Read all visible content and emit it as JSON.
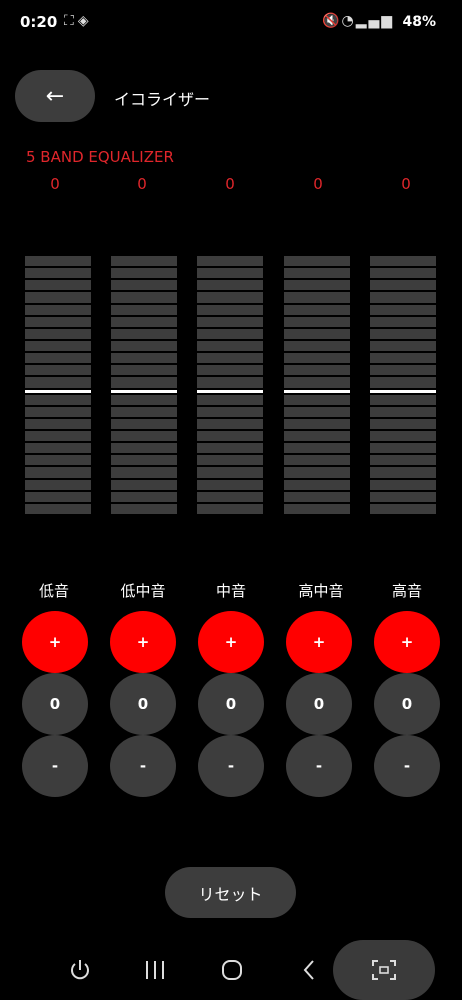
{
  "status_bar": {
    "time": "0:20",
    "battery": "48%",
    "left_icons": [
      "screenshot-icon",
      "alarm-icon"
    ],
    "right_icons": [
      "mute-icon",
      "wifi-icon",
      "signal-icon"
    ]
  },
  "header": {
    "back_label": "←",
    "title": "イコライザー"
  },
  "equalizer": {
    "label": "5 BAND EQUALIZER",
    "bands": [
      {
        "name": "低音",
        "value": "0",
        "plus": "+",
        "minus": "-"
      },
      {
        "name": "低中音",
        "value": "0",
        "plus": "+",
        "minus": "-"
      },
      {
        "name": "中音",
        "value": "0",
        "plus": "+",
        "minus": "-"
      },
      {
        "name": "高中音",
        "value": "0",
        "plus": "+",
        "minus": "-"
      },
      {
        "name": "高音",
        "value": "0",
        "plus": "+",
        "minus": "-"
      }
    ],
    "level_fraction": 0.5
  },
  "reset_label": "リセット",
  "colors": {
    "accent": "#ff0000",
    "value_text": "#e0262b",
    "button_gray": "#3d3d3d"
  },
  "navbar": {
    "icons": [
      "power-icon",
      "recents-icon",
      "home-icon",
      "back-icon",
      "capture-icon"
    ]
  }
}
